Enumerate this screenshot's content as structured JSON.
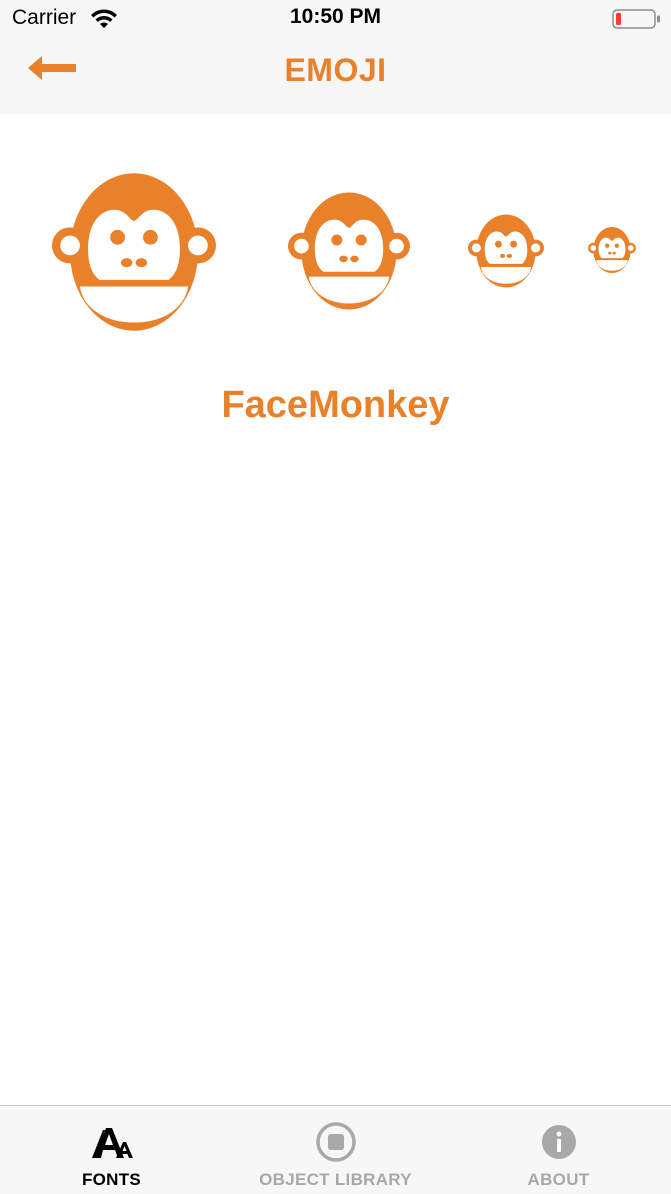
{
  "status_bar": {
    "carrier": "Carrier",
    "time": "10:50 PM",
    "wifi_icon": "wifi-icon",
    "battery_icon": "battery-low-icon",
    "battery_color": "#ff3b30"
  },
  "nav": {
    "back_icon": "arrow-left-icon",
    "title": "EMOJI"
  },
  "content": {
    "emoji_icon": "monkey-face-icon",
    "emoji_sizes_count": 4,
    "font_name": "FaceMonkey"
  },
  "tabs": [
    {
      "label": "FONTS",
      "icon": "fonts-icon",
      "active": true
    },
    {
      "label": "OBJECT LIBRARY",
      "icon": "stop-circle-icon",
      "active": false
    },
    {
      "label": "ABOUT",
      "icon": "info-icon",
      "active": false
    }
  ],
  "colors": {
    "accent": "#e8812a",
    "bar_background": "#f7f7f7",
    "inactive_tab": "#a8a8a8",
    "active_tab": "#000000"
  }
}
